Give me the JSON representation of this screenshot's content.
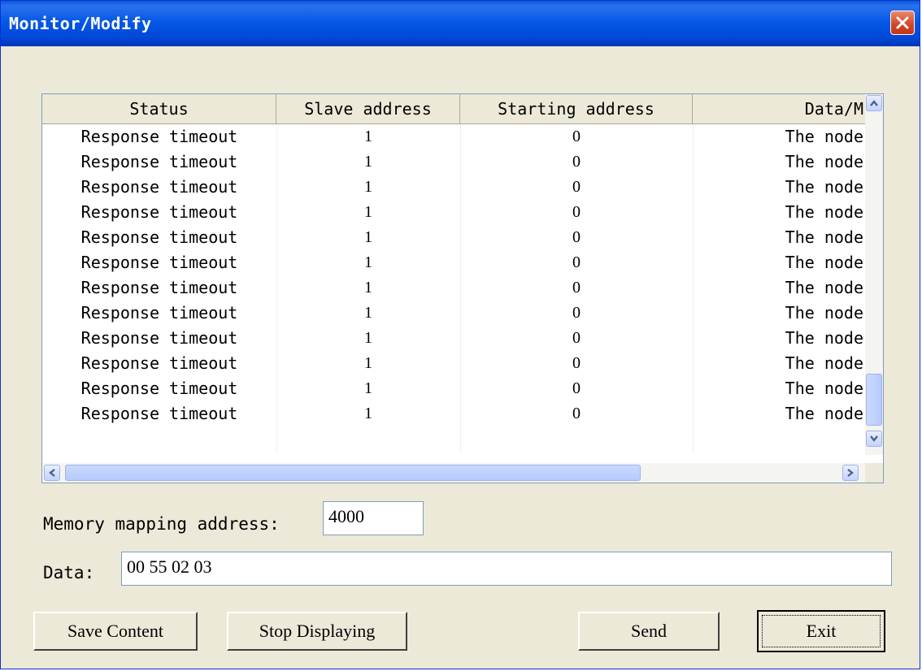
{
  "window": {
    "title": "Monitor/Modify"
  },
  "table": {
    "columns": [
      "Status",
      "Slave address",
      "Starting address",
      "Data/M"
    ],
    "rows": [
      [
        "Response timeout",
        "1",
        "0",
        "The node"
      ],
      [
        "Response timeout",
        "1",
        "0",
        "The node"
      ],
      [
        "Response timeout",
        "1",
        "0",
        "The node"
      ],
      [
        "Response timeout",
        "1",
        "0",
        "The node"
      ],
      [
        "Response timeout",
        "1",
        "0",
        "The node"
      ],
      [
        "Response timeout",
        "1",
        "0",
        "The node"
      ],
      [
        "Response timeout",
        "1",
        "0",
        "The node"
      ],
      [
        "Response timeout",
        "1",
        "0",
        "The node"
      ],
      [
        "Response timeout",
        "1",
        "0",
        "The node"
      ],
      [
        "Response timeout",
        "1",
        "0",
        "The node"
      ],
      [
        "Response timeout",
        "1",
        "0",
        "The node"
      ],
      [
        "Response timeout",
        "1",
        "0",
        "The node"
      ]
    ]
  },
  "memory": {
    "label": "Memory mapping address:",
    "value": "4000"
  },
  "data_field": {
    "label": "Data:",
    "value": "00 55 02 03"
  },
  "buttons": {
    "save": "Save Content",
    "stop": "Stop Displaying",
    "send": "Send",
    "exit": "Exit"
  },
  "icons": {
    "close": "close-icon",
    "scroll_up": "arrow-up-icon",
    "scroll_down": "arrow-down-icon",
    "scroll_left": "arrow-left-icon",
    "scroll_right": "arrow-right-icon"
  },
  "colors": {
    "titlebar": "#0658e6",
    "close": "#d24522",
    "window_bg": "#ece9d8"
  }
}
